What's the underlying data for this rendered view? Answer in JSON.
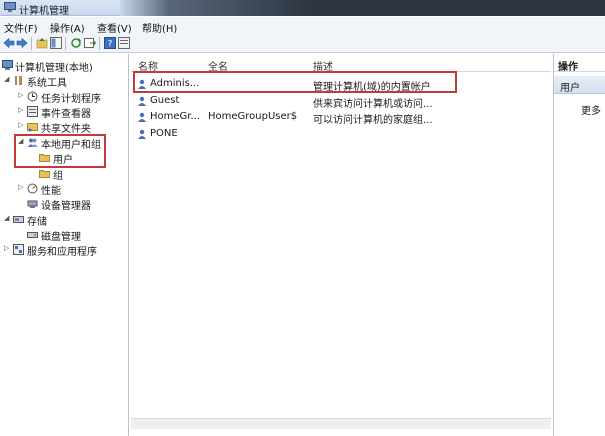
{
  "window": {
    "title": "计算机管理"
  },
  "menu": {
    "items": [
      {
        "label": "文件(F)"
      },
      {
        "label": "操作(A)"
      },
      {
        "label": "查看(V)"
      },
      {
        "label": "帮助(H)"
      }
    ]
  },
  "toolbar": {
    "icons": [
      "back-icon",
      "forward-icon",
      "up-folder-icon",
      "show-hide-tree-icon",
      "refresh-icon",
      "export-list-icon",
      "help-icon",
      "properties-icon"
    ]
  },
  "tree": {
    "root": {
      "label": "计算机管理(本地)"
    },
    "system_tools": {
      "label": "系统工具"
    },
    "task_scheduler": {
      "label": "任务计划程序"
    },
    "event_viewer": {
      "label": "事件查看器"
    },
    "shared_folders": {
      "label": "共享文件夹"
    },
    "local_users_groups": {
      "label": "本地用户和组"
    },
    "users": {
      "label": "用户"
    },
    "groups": {
      "label": "组"
    },
    "performance": {
      "label": "性能"
    },
    "device_manager": {
      "label": "设备管理器"
    },
    "storage": {
      "label": "存储"
    },
    "disk_management": {
      "label": "磁盘管理"
    },
    "services_apps": {
      "label": "服务和应用程序"
    }
  },
  "list": {
    "columns": {
      "name": "名称",
      "full_name": "全名",
      "description": "描述"
    },
    "rows": [
      {
        "name": "Adminis...",
        "full_name": "",
        "description": "管理计算机(域)的内置帐户"
      },
      {
        "name": "Guest",
        "full_name": "",
        "description": "供来宾访问计算机或访问..."
      },
      {
        "name": "HomeGr...",
        "full_name": "HomeGroupUser$",
        "description": "可以访问计算机的家庭组..."
      },
      {
        "name": "PONE",
        "full_name": "",
        "description": ""
      }
    ]
  },
  "actions": {
    "header": "操作",
    "group": "用户",
    "more": "更多"
  },
  "colors": {
    "highlight_box": "#c23a3a",
    "folder": "#e8c25a",
    "user_icon": "#4a6fb0"
  }
}
